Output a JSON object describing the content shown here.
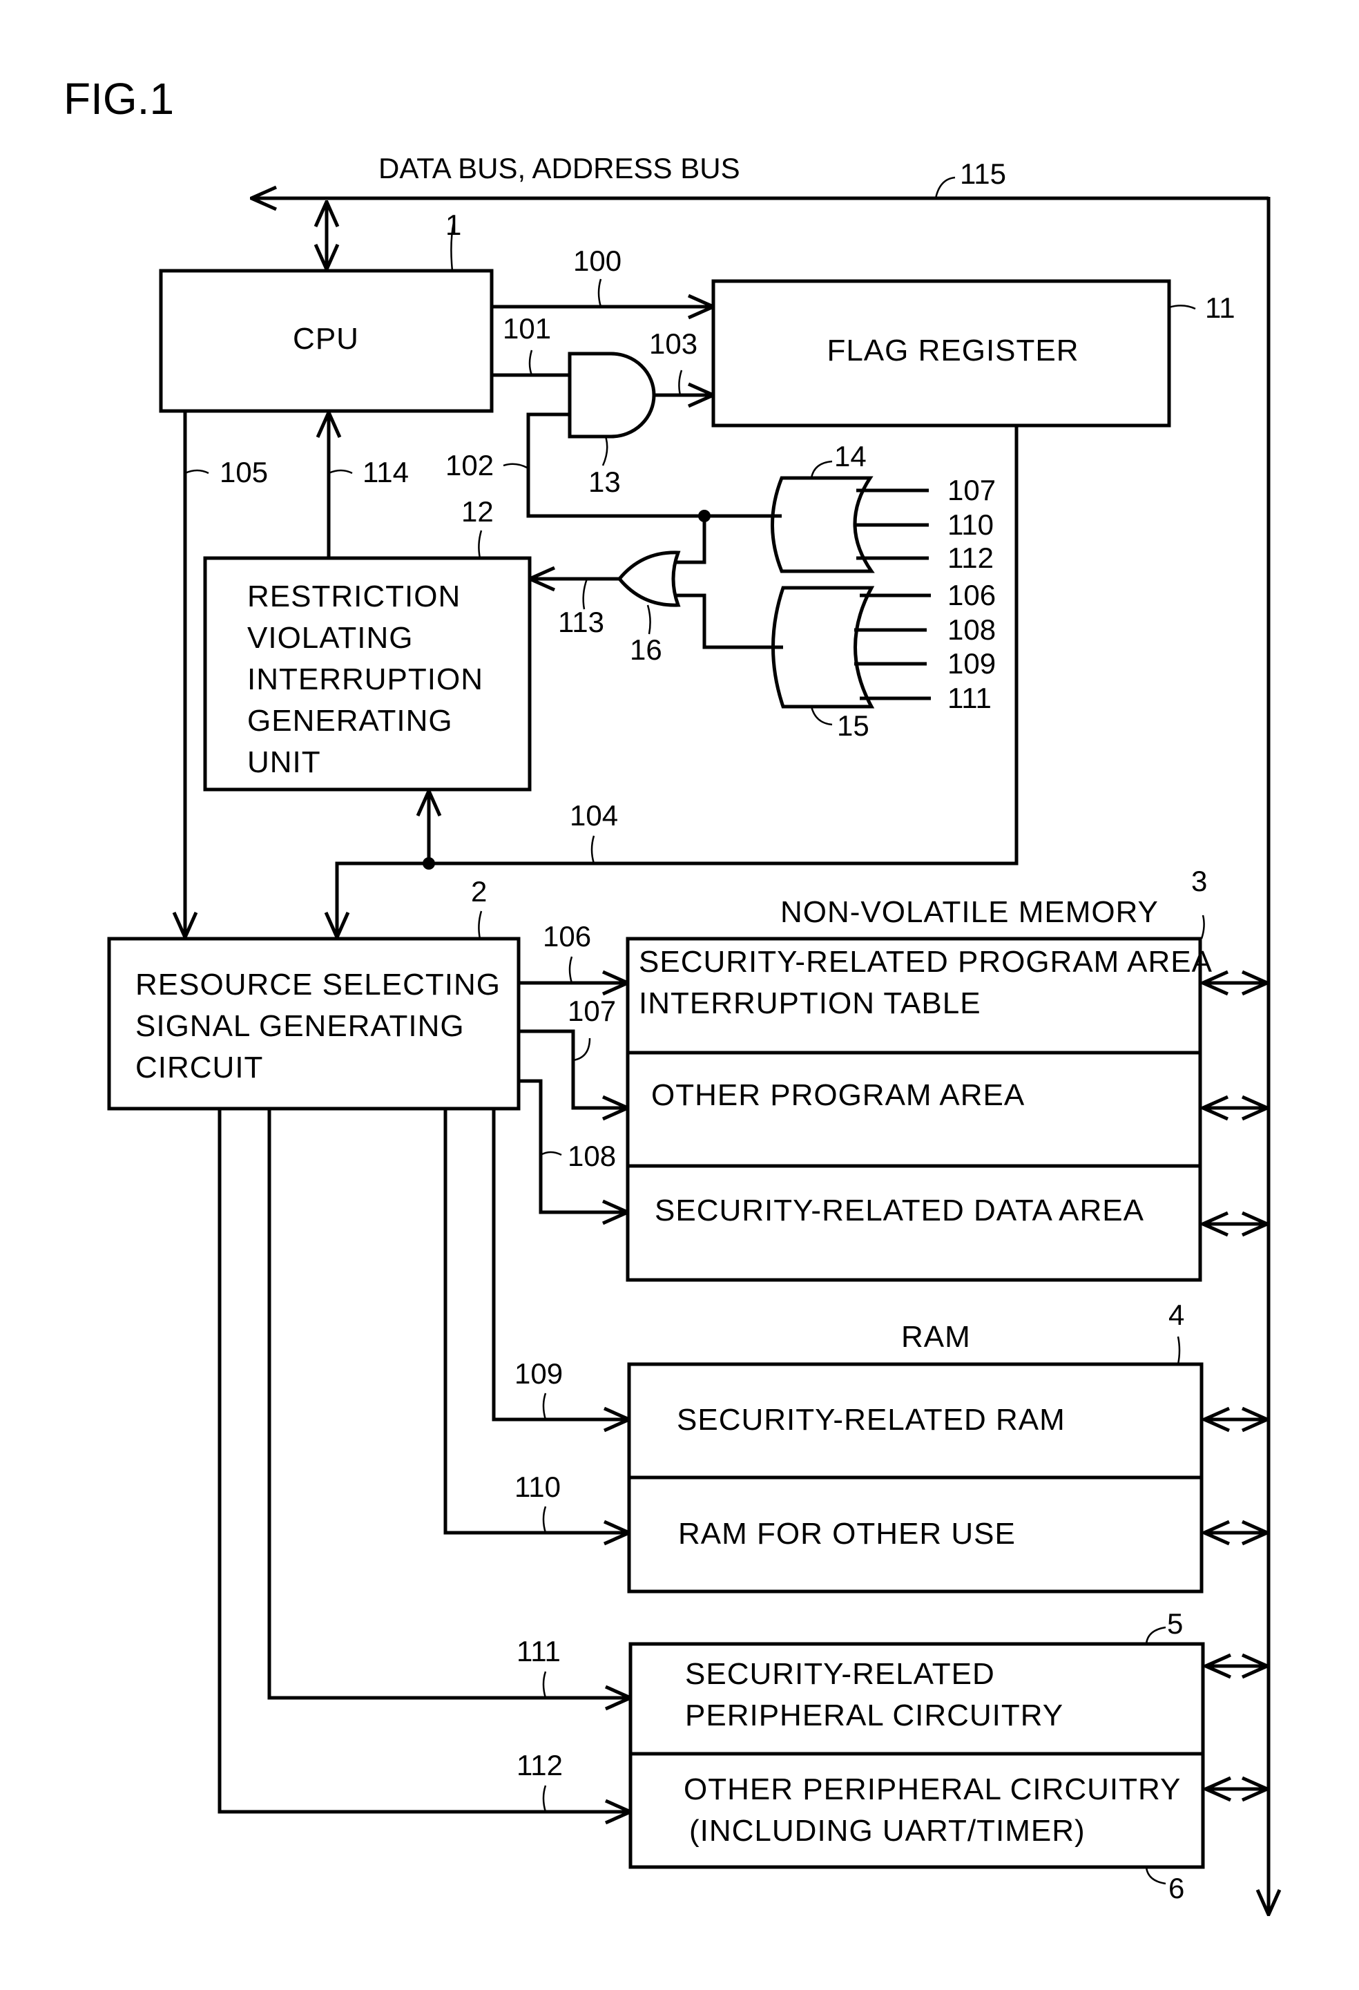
{
  "figure": {
    "title": "FIG.1",
    "bus_label": "DATA BUS, ADDRESS BUS",
    "blocks": {
      "cpu": {
        "label": "CPU",
        "ref": "1"
      },
      "flag_register": {
        "label": "FLAG REGISTER",
        "ref": "11"
      },
      "restriction_unit": {
        "lines": [
          "RESTRICTION",
          "VIOLATING",
          "INTERRUPTION",
          "GENERATING",
          "UNIT"
        ],
        "ref": "12"
      },
      "resource_selector": {
        "lines": [
          "RESOURCE SELECTING",
          "SIGNAL GENERATING",
          "CIRCUIT"
        ],
        "ref": "2"
      },
      "non_volatile_memory": {
        "title": "NON-VOLATILE MEMORY",
        "ref": "3",
        "areas": [
          {
            "lines": [
              "SECURITY-RELATED PROGRAM AREA",
              "INTERRUPTION TABLE"
            ]
          },
          {
            "lines": [
              "OTHER PROGRAM AREA"
            ]
          },
          {
            "lines": [
              "SECURITY-RELATED DATA AREA"
            ]
          }
        ]
      },
      "ram": {
        "title": "RAM",
        "ref": "4",
        "areas": [
          {
            "lines": [
              "SECURITY-RELATED RAM"
            ]
          },
          {
            "lines": [
              "RAM FOR OTHER USE"
            ]
          }
        ]
      },
      "peripheral": {
        "areas": [
          {
            "lines": [
              "SECURITY-RELATED",
              "PERIPHERAL CIRCUITRY"
            ],
            "ref": "5"
          },
          {
            "lines": [
              "OTHER PERIPHERAL CIRCUITRY",
              "(INCLUDING UART/TIMER)"
            ],
            "ref": "6"
          }
        ]
      }
    },
    "gates": {
      "and_gate": {
        "ref": "13"
      },
      "or_gate_a": {
        "ref": "14",
        "inputs": [
          "107",
          "110",
          "112"
        ]
      },
      "or_gate_b": {
        "ref": "15",
        "inputs": [
          "106",
          "108",
          "109",
          "111"
        ]
      },
      "or_gate_c": {
        "ref": "16"
      }
    },
    "signals": {
      "s100": "100",
      "s101": "101",
      "s102": "102",
      "s103": "103",
      "s104": "104",
      "s105": "105",
      "s106": "106",
      "s107": "107",
      "s108": "108",
      "s109": "109",
      "s110": "110",
      "s111": "111",
      "s112": "112",
      "s113": "113",
      "s114": "114",
      "s115": "115"
    }
  }
}
